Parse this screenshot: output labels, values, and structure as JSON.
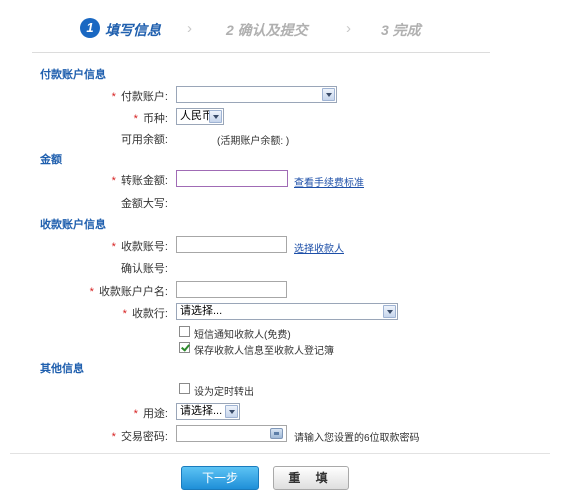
{
  "steps": {
    "step1_num": "1",
    "step1_label": "填写信息",
    "step2_label": "2 确认及提交",
    "step3_label": "3 完成",
    "separator": "›"
  },
  "sections": {
    "payer": "付款账户信息",
    "amount": "金额",
    "payee": "收款账户信息",
    "other": "其他信息"
  },
  "required_mark": "*",
  "payer": {
    "account_label": "付款账户:",
    "account_value": "",
    "currency_label": "币种:",
    "currency_value": "人民币",
    "balance_label": "可用余额:",
    "balance_note": "(活期账户余额:        )"
  },
  "amount": {
    "transfer_label": "转账金额:",
    "transfer_value": "",
    "fee_link": "查看手续费标准",
    "uppercase_label": "金额大写:"
  },
  "payee": {
    "account_no_label": "收款账号:",
    "account_no_value": "",
    "select_payee_link": "选择收款人",
    "confirm_label": "确认账号:",
    "name_label": "收款账户户名:",
    "name_value": "",
    "bank_label": "收款行:",
    "bank_value": "请选择...",
    "sms_notify_label": "短信通知收款人(免费)",
    "sms_notify_checked": false,
    "save_payee_label": "保存收款人信息至收款人登记簿",
    "save_payee_checked": true
  },
  "other": {
    "scheduled_label": "设为定时转出",
    "scheduled_checked": false,
    "purpose_label": "用途:",
    "purpose_value": "请选择...",
    "password_label": "交易密码:",
    "password_value": "",
    "password_hint": "请输入您设置的6位取款密码"
  },
  "buttons": {
    "next": "下一步",
    "reset": "重 填"
  },
  "colors": {
    "accent": "#1f5fae",
    "required": "#d62020",
    "link": "#1d4fa8",
    "primary_button": "#1f8fd8"
  }
}
